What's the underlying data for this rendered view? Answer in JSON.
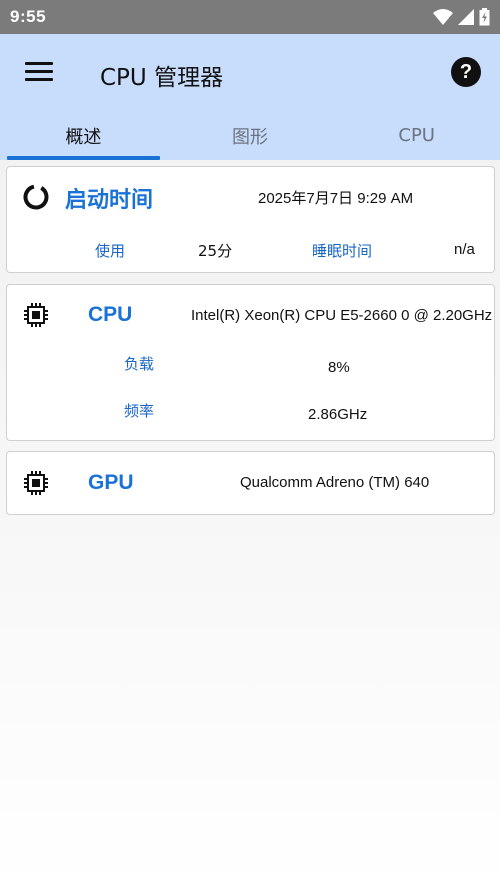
{
  "status_bar": {
    "time": "9:55"
  },
  "app_bar": {
    "title": "CPU 管理器",
    "help_label": "?"
  },
  "tabs": [
    {
      "label": "概述",
      "active": true
    },
    {
      "label": "图形",
      "active": false
    },
    {
      "label": "CPU",
      "active": false
    }
  ],
  "uptime_card": {
    "title": "启动时间",
    "boot_time": "2025年7月7日 9:29 AM",
    "usage_label": "使用",
    "usage_value": "25分",
    "sleep_label": "睡眠时间",
    "sleep_value": "n/a"
  },
  "cpu_card": {
    "title": "CPU",
    "model": "Intel(R) Xeon(R) CPU E5-2660 0 @ 2.20GHz",
    "load_label": "负载",
    "load_value": "8%",
    "freq_label": "频率",
    "freq_value": "2.86GHz"
  },
  "gpu_card": {
    "title": "GPU",
    "model": "Qualcomm Adreno (TM) 640"
  },
  "colors": {
    "accent": "#1a72d6",
    "app_bar": "#c8dcfb",
    "status_bar": "#7b7b7b",
    "label_blue": "#1a66c6"
  }
}
